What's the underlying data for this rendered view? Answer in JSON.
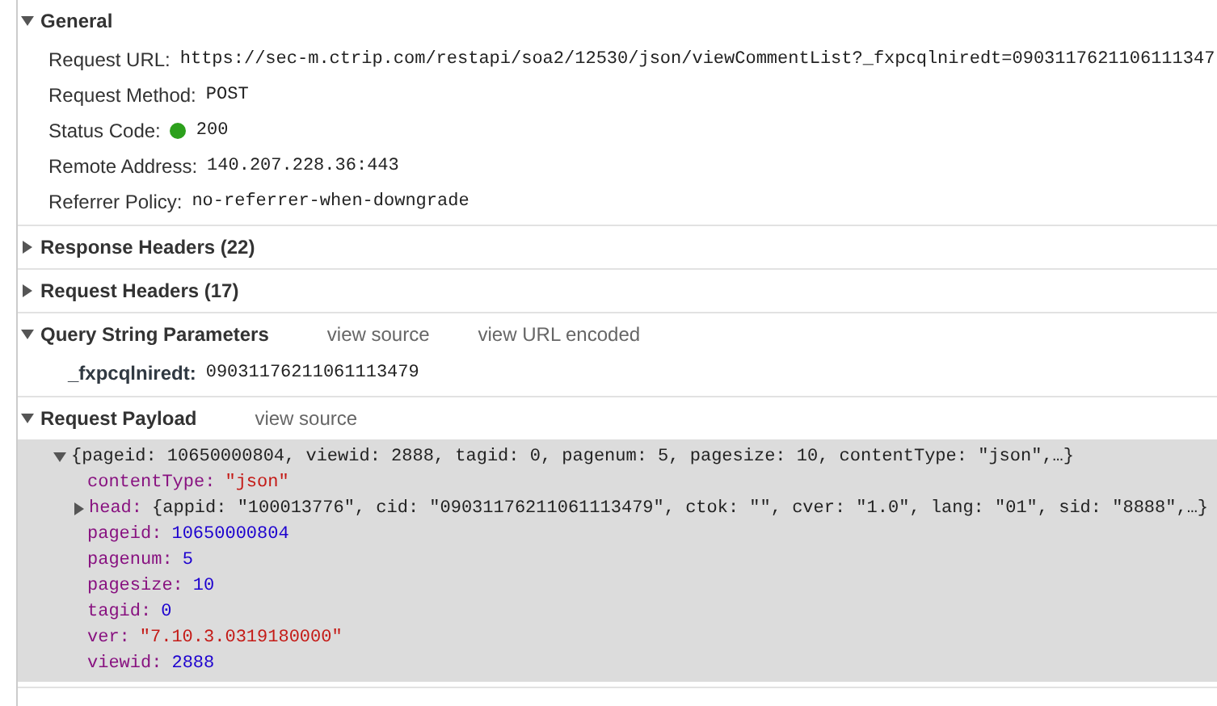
{
  "sections": [
    {
      "title": "General",
      "expanded": true,
      "rows": [
        {
          "label": "Request URL:",
          "value": "https://sec-m.ctrip.com/restapi/soa2/12530/json/viewCommentList?_fxpcqlniredt=0903117621106111347",
          "kind": "text"
        },
        {
          "label": "Request Method:",
          "value": "POST",
          "kind": "text"
        },
        {
          "label": "Status Code:",
          "value": "200",
          "kind": "status"
        },
        {
          "label": "Remote Address:",
          "value": "140.207.228.36:443",
          "kind": "text"
        },
        {
          "label": "Referrer Policy:",
          "value": "no-referrer-when-downgrade",
          "kind": "text"
        }
      ]
    },
    {
      "title": "Response Headers (22)",
      "expanded": false
    },
    {
      "title": "Request Headers (17)",
      "expanded": false
    },
    {
      "title": "Query String Parameters",
      "expanded": true,
      "links": [
        "view source",
        "view URL encoded"
      ],
      "rows": [
        {
          "label": "_fxpcqlniredt:",
          "value": "09031176211061113479",
          "kind": "text"
        }
      ]
    },
    {
      "title": "Request Payload",
      "expanded": true,
      "links": [
        "view source"
      ],
      "payload": {
        "summary": "{pageid: 10650000804, viewid: 2888, tagid: 0, pagenum: 5, pagesize: 10, contentType: \"json\",…}",
        "expanded": true,
        "children": [
          {
            "key": "contentType:",
            "value": "\"json\"",
            "kind": "string"
          },
          {
            "key": "head:",
            "value": "{appid: \"100013776\", cid: \"09031176211061113479\", ctok: \"\", cver: \"1.0\", lang: \"01\", sid: \"8888\",…}",
            "kind": "object",
            "expanded": false
          },
          {
            "key": "pageid:",
            "value": "10650000804",
            "kind": "number"
          },
          {
            "key": "pagenum:",
            "value": "5",
            "kind": "number"
          },
          {
            "key": "pagesize:",
            "value": "10",
            "kind": "number"
          },
          {
            "key": "tagid:",
            "value": "0",
            "kind": "number"
          },
          {
            "key": "ver:",
            "value": "\"7.10.3.0319180000\"",
            "kind": "string"
          },
          {
            "key": "viewid:",
            "value": "2888",
            "kind": "number"
          }
        ]
      }
    }
  ]
}
